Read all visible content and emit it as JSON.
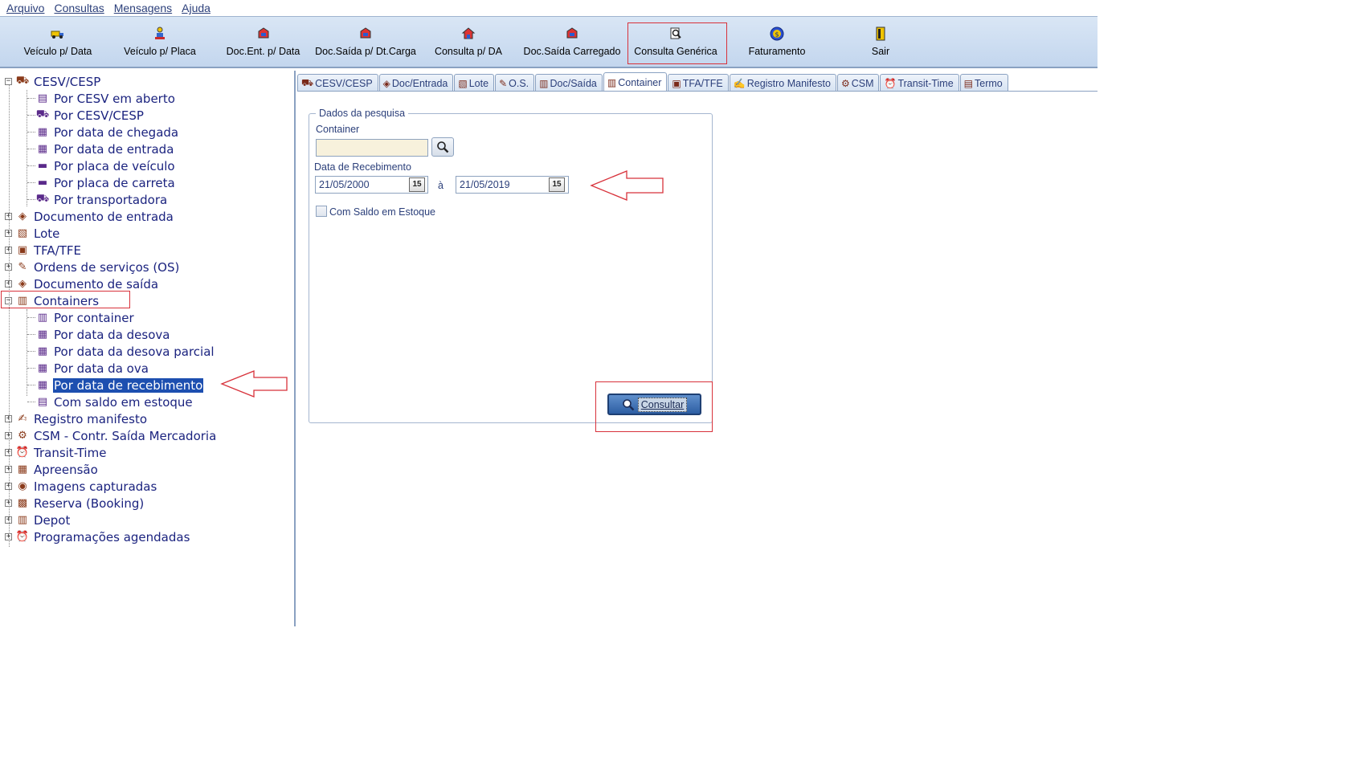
{
  "menu": [
    "Arquivo",
    "Consultas",
    "Mensagens",
    "Ajuda"
  ],
  "toolbar": [
    {
      "label": "Veículo p/ Data",
      "icon": "truck-icon"
    },
    {
      "label": "Veículo p/ Placa",
      "icon": "person-truck-icon"
    },
    {
      "label": "Doc.Ent. p/ Data",
      "icon": "doc-in-icon"
    },
    {
      "label": "Doc.Saída p/ Dt.Carga",
      "icon": "doc-out-icon"
    },
    {
      "label": "Consulta p/ DA",
      "icon": "house-icon"
    },
    {
      "label": "Doc.Saída Carregado",
      "icon": "doc-loaded-icon"
    },
    {
      "label": "Consulta Genérica",
      "icon": "search-doc-icon"
    },
    {
      "label": "Faturamento",
      "icon": "coin-icon"
    },
    {
      "label": "Sair",
      "icon": "exit-door-icon"
    }
  ],
  "tree": [
    {
      "label": "CESV/CESP",
      "level": 0,
      "expander": "−",
      "icon": "⛟"
    },
    {
      "label": "Por CESV em aberto",
      "level": 1,
      "icon": "▤"
    },
    {
      "label": "Por CESV/CESP",
      "level": 1,
      "icon": "⛟"
    },
    {
      "label": "Por data de chegada",
      "level": 1,
      "icon": "▦"
    },
    {
      "label": "Por data de entrada",
      "level": 1,
      "icon": "▦"
    },
    {
      "label": "Por placa de veículo",
      "level": 1,
      "icon": "▬"
    },
    {
      "label": "Por placa de carreta",
      "level": 1,
      "icon": "▬"
    },
    {
      "label": "Por transportadora",
      "level": 1,
      "icon": "⛟"
    },
    {
      "label": "Documento de entrada",
      "level": 0,
      "expander": "+",
      "icon": "◈"
    },
    {
      "label": "Lote",
      "level": 0,
      "expander": "+",
      "icon": "▧"
    },
    {
      "label": "TFA/TFE",
      "level": 0,
      "expander": "+",
      "icon": "▣"
    },
    {
      "label": "Ordens de serviços (OS)",
      "level": 0,
      "expander": "+",
      "icon": "✎"
    },
    {
      "label": "Documento de saída",
      "level": 0,
      "expander": "+",
      "icon": "◈"
    },
    {
      "label": "Containers",
      "level": 0,
      "expander": "−",
      "icon": "▥"
    },
    {
      "label": "Por container",
      "level": 1,
      "icon": "▥"
    },
    {
      "label": "Por data da desova",
      "level": 1,
      "icon": "▦"
    },
    {
      "label": "Por data da desova parcial",
      "level": 1,
      "icon": "▦"
    },
    {
      "label": "Por data da ova",
      "level": 1,
      "icon": "▦"
    },
    {
      "label": "Por data de recebimento",
      "level": 1,
      "icon": "▦",
      "selected": true
    },
    {
      "label": "Com saldo em estoque",
      "level": 1,
      "icon": "▤"
    },
    {
      "label": "Registro manifesto",
      "level": 0,
      "expander": "+",
      "icon": "✍"
    },
    {
      "label": "CSM - Contr. Saída Mercadoria",
      "level": 0,
      "expander": "+",
      "icon": "⚙"
    },
    {
      "label": "Transit-Time",
      "level": 0,
      "expander": "+",
      "icon": "⏰"
    },
    {
      "label": "Apreensão",
      "level": 0,
      "expander": "+",
      "icon": "▦"
    },
    {
      "label": "Imagens capturadas",
      "level": 0,
      "expander": "+",
      "icon": "◉"
    },
    {
      "label": "Reserva (Booking)",
      "level": 0,
      "expander": "+",
      "icon": "▩"
    },
    {
      "label": "Depot",
      "level": 0,
      "expander": "+",
      "icon": "▥"
    },
    {
      "label": "Programações agendadas",
      "level": 0,
      "expander": "+",
      "icon": "⏰"
    }
  ],
  "tabs": [
    {
      "label": "CESV/CESP",
      "icon": "⛟"
    },
    {
      "label": "Doc/Entrada",
      "icon": "◈"
    },
    {
      "label": "Lote",
      "icon": "▧"
    },
    {
      "label": "O.S.",
      "icon": "✎"
    },
    {
      "label": "Doc/Saída",
      "icon": "▥"
    },
    {
      "label": "Container",
      "icon": "▥",
      "active": true
    },
    {
      "label": "TFA/TFE",
      "icon": "▣"
    },
    {
      "label": "Registro Manifesto",
      "icon": "✍"
    },
    {
      "label": "CSM",
      "icon": "⚙"
    },
    {
      "label": "Transit-Time",
      "icon": "⏰"
    },
    {
      "label": "Termo",
      "icon": "▤"
    }
  ],
  "search": {
    "legend": "Dados da pesquisa",
    "container_label": "Container",
    "container_value": "",
    "date_label": "Data de Recebimento",
    "date_from": "21/05/2000",
    "date_sep": "à",
    "date_to": "21/05/2019",
    "cal_icon_text": "15",
    "stock_label": "Com Saldo em Estoque",
    "stock_checked": false,
    "consultar_label": "Consultar"
  },
  "colors": {
    "accent": "#1d4fb0",
    "highlight": "#d8323b",
    "toolbar": "#c3d6ee"
  }
}
